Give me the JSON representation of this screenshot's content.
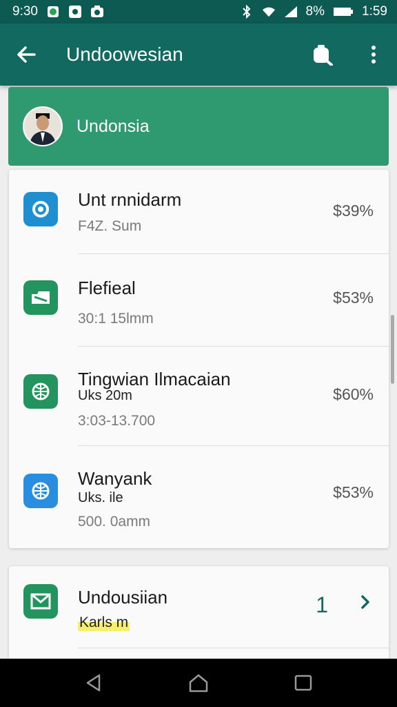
{
  "status_bar": {
    "time": "9:30",
    "battery": "8%",
    "clock": "1:59",
    "icons": [
      "whatsapp-icon",
      "notification-icon",
      "camera-icon",
      "bluetooth-icon",
      "wifi-icon",
      "signal-icon",
      "battery-icon"
    ]
  },
  "app_bar": {
    "title": "Undoowesian",
    "icons": [
      "back-arrow-icon",
      "search-icon",
      "more-vert-icon"
    ]
  },
  "account": {
    "name": "Undonsia",
    "avatar": "avatar"
  },
  "list": [
    {
      "title": "Unt rnnidarm",
      "subtitle": "",
      "meta": "F4Z. Sum",
      "value": "$39%",
      "icon": "sync-icon",
      "icon_color": "#1f8fd0"
    },
    {
      "title": "Flefieal",
      "subtitle": "",
      "meta": "30:1 15lmm",
      "value": "$53%",
      "icon": "folder-icon",
      "icon_color": "#23945d"
    },
    {
      "title": "Tingwian Ilmacaian",
      "subtitle": "Uks 20m",
      "meta": "3:03-13.700",
      "value": "$60%",
      "icon": "globe-icon",
      "icon_color": "#23945d"
    },
    {
      "title": "Wanyank",
      "subtitle": "Uks. ile",
      "meta": "500. 0amm",
      "value": "$53%",
      "icon": "globe-icon",
      "icon_color": "#2a8ee0"
    }
  ],
  "second_card": {
    "title": "Undousiian",
    "subtitle": "Karls m",
    "badge": "1",
    "icon": "mail-icon",
    "icon_color": "#23945d"
  },
  "colors": {
    "primary": "#11695f",
    "status_bar": "#0c5a52",
    "accent": "#2f9a6f"
  },
  "nav": {
    "icons": [
      "back-nav-icon",
      "home-nav-icon",
      "recents-nav-icon"
    ]
  }
}
